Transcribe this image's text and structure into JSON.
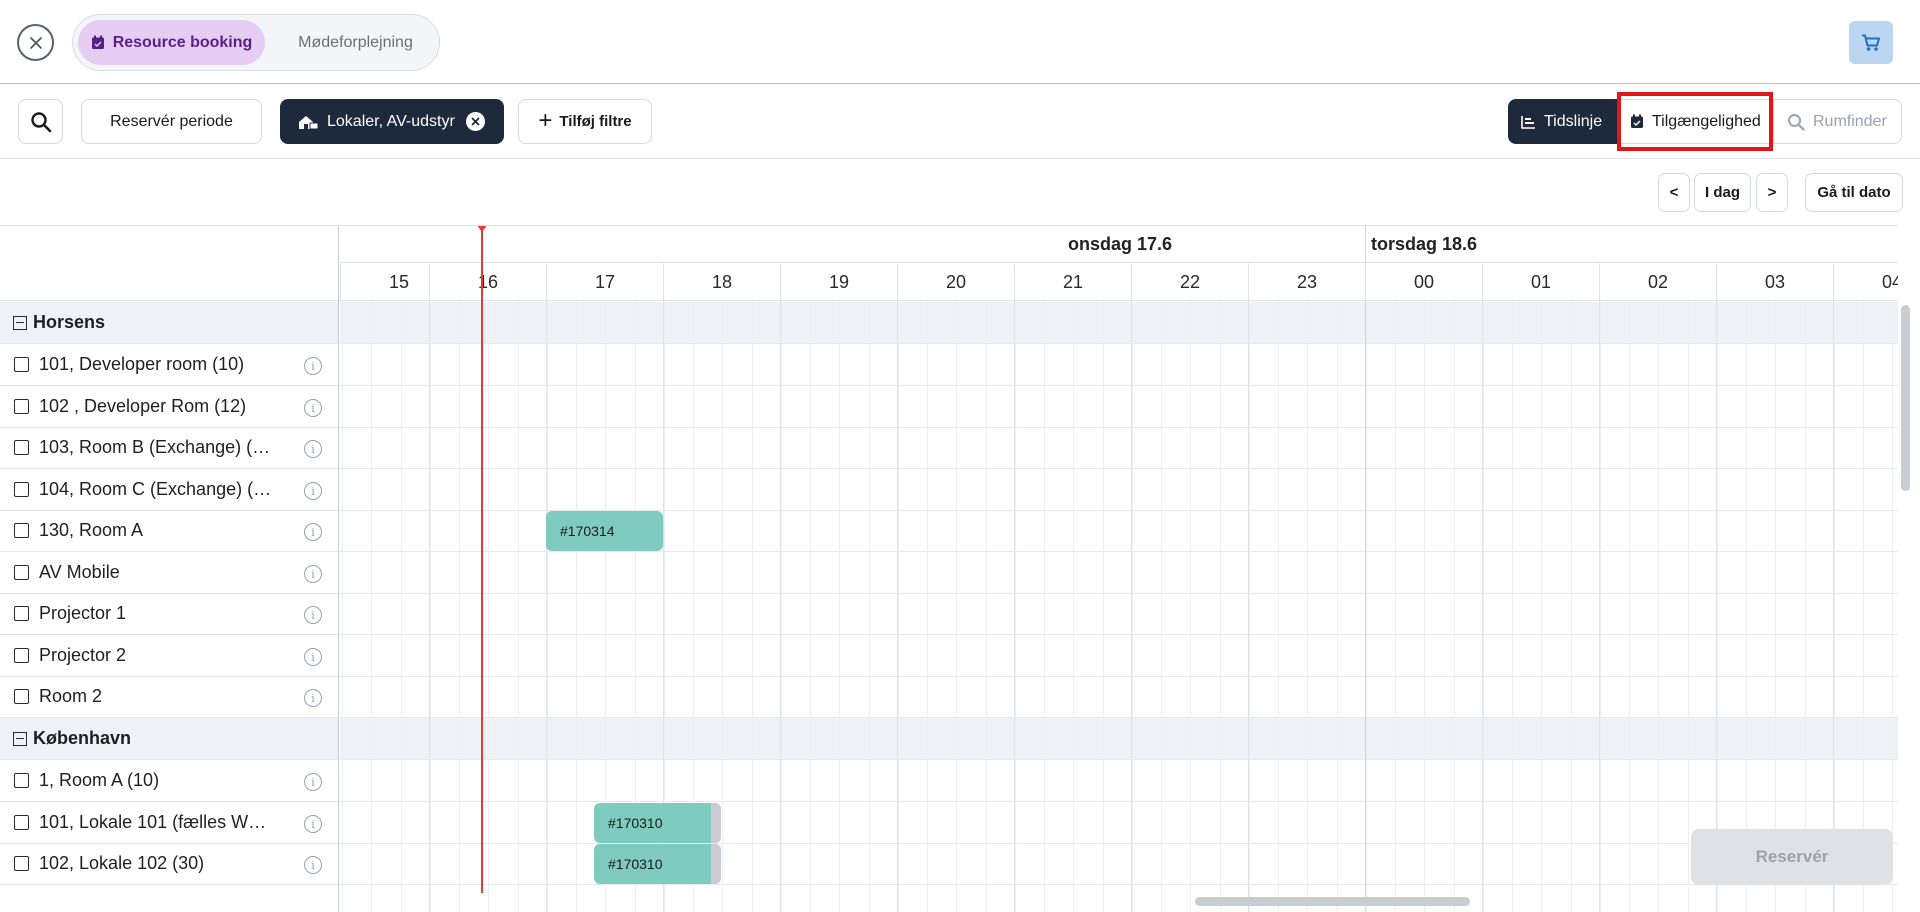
{
  "header": {
    "tabs": [
      {
        "label": "Resource booking",
        "active": true,
        "icon": "calendar-check-icon"
      },
      {
        "label": "Mødeforplejning",
        "active": false
      }
    ],
    "close_icon": "close-icon",
    "cart_icon": "cart-icon"
  },
  "toolbar": {
    "search_icon": "search-icon",
    "reserve_period_label": "Reservér periode",
    "filter_chip_label": "Lokaler, AV-udstyr",
    "add_filter_label": "Tilføj filtre",
    "views": [
      {
        "label": "Tidslinje",
        "active": true,
        "icon": "timeline-icon"
      },
      {
        "label": "Tilgængelighed",
        "active": false,
        "highlighted": true,
        "icon": "calendar-check-icon"
      },
      {
        "label": "Rumfinder",
        "active": false,
        "disabled": true,
        "icon": "search-room-icon"
      }
    ]
  },
  "date_nav": {
    "prev_label": "<",
    "today_label": "I dag",
    "next_label": ">",
    "goto_label": "Gå til dato"
  },
  "timeline": {
    "days": [
      "onsdag 17.6",
      "torsdag 18.6"
    ],
    "hours": [
      "15",
      "16",
      "17",
      "18",
      "19",
      "20",
      "21",
      "22",
      "23",
      "00",
      "01",
      "02",
      "03",
      "04"
    ],
    "now_hour": "16"
  },
  "groups": [
    {
      "name": "Horsens",
      "resources": [
        {
          "label": "101, Developer room (10)"
        },
        {
          "label": "102 , Developer Rom (12)"
        },
        {
          "label": "103, Room B (Exchange) (…"
        },
        {
          "label": "104, Room C (Exchange) (…"
        },
        {
          "label": "130, Room A"
        },
        {
          "label": "AV Mobile"
        },
        {
          "label": "Projector 1"
        },
        {
          "label": "Projector 2"
        },
        {
          "label": "Room 2"
        }
      ]
    },
    {
      "name": "København",
      "resources": [
        {
          "label": "1, Room A (10)"
        },
        {
          "label": "101, Lokale 101 (fælles W…"
        },
        {
          "label": "102, Lokale 102 (30)"
        }
      ]
    }
  ],
  "bookings": [
    {
      "id": "#170314",
      "resource": "130, Room A"
    },
    {
      "id": "#170310",
      "resource": "101, Lokale 101 (fælles W…"
    },
    {
      "id": "#170310",
      "resource": "102, Lokale 102 (30)"
    }
  ],
  "reserve_button_label": "Reservér",
  "colors": {
    "accent_dark": "#1e2a3b",
    "tab_active_bg": "#e6cdf3",
    "tab_active_text": "#5a1f86",
    "booking": "#7fcbc0",
    "now_line": "#e53935",
    "highlight_box": "#e3151b",
    "cart_bg": "#bcd6f2"
  }
}
